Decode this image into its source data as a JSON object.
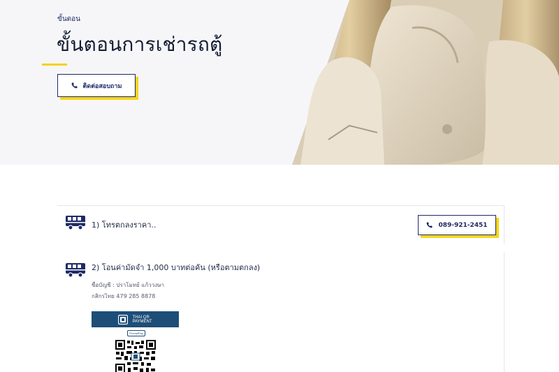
{
  "hero": {
    "breadcrumb": "ขั้นตอน",
    "title": "ขั้นตอนการเช่ารถตู้",
    "contact_button_label": "ติดต่อสอบถาม",
    "accent_color": "#f5d61c",
    "brand_color": "#1e2a66"
  },
  "steps": [
    {
      "icon": "bus-icon",
      "title": "1) โทรตกลงราคา..",
      "phone_button_label": "089-921-2451"
    },
    {
      "icon": "bus-icon",
      "title": "2) โอนค่ามัดจำ 1,000 บาทต่อคัน (หรือตามตกลง)",
      "account_name": "ชื่อบัญชี : ปราโมทย์ แก้ววงษา",
      "bank_account": "กสิกรไทย 479 285 8878",
      "qr": {
        "header_line1": "THAI QR",
        "header_line2": "PAYMENT",
        "promptpay_label": "PromptPay"
      }
    }
  ]
}
